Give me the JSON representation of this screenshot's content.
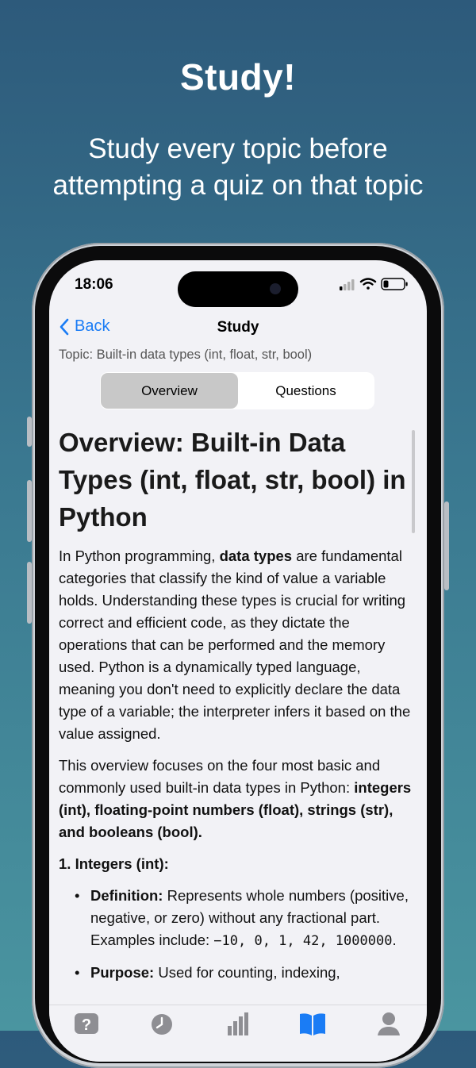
{
  "promo": {
    "headline": "Study!",
    "subline_1": "Study every topic before",
    "subline_2": "attempting a quiz on that topic"
  },
  "status_bar": {
    "time": "18:06"
  },
  "nav": {
    "back_label": "Back",
    "title": "Study"
  },
  "topic_label": "Topic: Built-in data types (int, float, str, bool)",
  "segmented": {
    "items": [
      "Overview",
      "Questions"
    ],
    "selected": "Overview"
  },
  "article": {
    "title": "Overview: Built-in Data Types (int, float, str, bool) in Python",
    "p1_a": "In Python programming, ",
    "p1_bold": "data types",
    "p1_b": " are fundamental categories that classify the kind of value a variable holds. Understanding these types is crucial for writing correct and efficient code, as they dictate the operations that can be performed and the memory used. Python is a dynamically typed language, meaning you don't need to explicitly declare the data type of a variable; the interpreter infers it based on the value assigned.",
    "p2_a": "This overview focuses on the four most basic and commonly used built-in data types in Python: ",
    "p2_bold": "integers (int), floating-point numbers (float), strings (str), and booleans (bool).",
    "section1": "1. Integers (int):",
    "b1_label": "Definition:",
    "b1_text": " Represents whole numbers (positive, negative, or zero) without any fractional part. Examples include: ",
    "b1_code": "−10, 0, 1, 42, 1000000",
    "b1_end": ".",
    "b2_label": "Purpose:",
    "b2_text": "  Used for counting, indexing,"
  },
  "tabbar": {
    "tabs": [
      {
        "name": "quiz-icon"
      },
      {
        "name": "history-icon"
      },
      {
        "name": "stats-icon"
      },
      {
        "name": "study-icon"
      },
      {
        "name": "profile-icon"
      }
    ],
    "active_color": "#1a7cf5",
    "inactive_color": "#8e8e93"
  }
}
